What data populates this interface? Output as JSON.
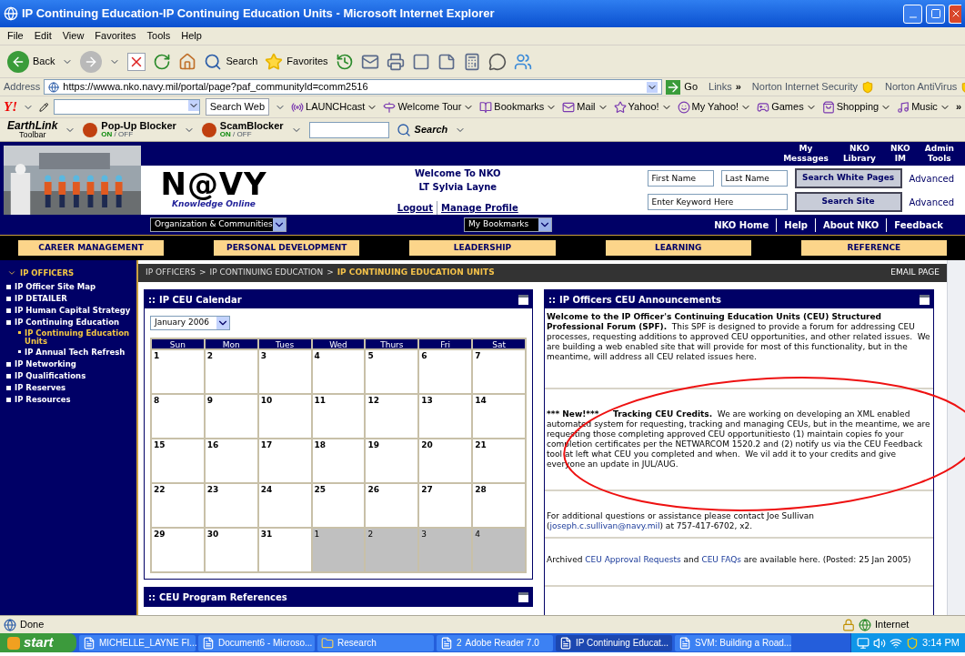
{
  "browser": {
    "title": "IP Continuing Education-IP Continuing Education Units - Microsoft Internet Explorer",
    "menu": [
      "File",
      "Edit",
      "View",
      "Favorites",
      "Tools",
      "Help"
    ],
    "toolbar": {
      "back": "Back",
      "search": "Search",
      "favorites": "Favorites"
    },
    "address": {
      "label": "Address",
      "url": "https://wwwa.nko.navy.mil/portal/page?paf_communityId=comm2516",
      "go": "Go",
      "links": "Links",
      "more": "»",
      "addons": [
        "Norton Internet Security",
        "Norton AntiVirus"
      ]
    },
    "yahoo_bar": {
      "logo": "Y!",
      "search_button": "Search Web",
      "items": [
        "LAUNCHcast",
        "Welcome Tour",
        "Bookmarks",
        "Mail",
        "Yahoo!",
        "My Yahoo!",
        "Games",
        "Shopping",
        "Music"
      ],
      "more": "»"
    },
    "earthlink_bar": {
      "logo": "EarthLink",
      "logo_sub": "Toolbar",
      "blockers": [
        {
          "label": "Pop-Up Blocker",
          "on": "ON",
          "off": "/ OFF"
        },
        {
          "label": "ScamBlocker",
          "on": "ON",
          "off": "/ OFF"
        }
      ],
      "search": "Search"
    }
  },
  "header": {
    "top_links": [
      "My Messages",
      "NKO Library",
      "NKO IM",
      "Admin Tools"
    ],
    "logo": {
      "main": "N@VY",
      "sub": "Knowledge Online"
    },
    "welcome": {
      "line1": "Welcome To NKO",
      "line2": "LT Sylvia Layne",
      "links": [
        "Logout",
        "Manage Profile"
      ]
    },
    "people_search": {
      "fields": [
        {
          "placeholder": "First Name"
        },
        {
          "placeholder": "Last Name"
        }
      ],
      "button": "Search White Pages",
      "advanced": "Advanced"
    },
    "site_search": {
      "placeholder": "Enter Keyword Here",
      "button": "Search Site",
      "advanced": "Advanced"
    },
    "dropdowns": [
      "Organization & Communities",
      "My Bookmarks"
    ],
    "nav_links": [
      "NKO Home",
      "Help",
      "About NKO",
      "Feedback"
    ],
    "tabs": [
      "CAREER MANAGEMENT",
      "PERSONAL DEVELOPMENT",
      "LEADERSHIP",
      "LEARNING",
      "REFERENCE"
    ]
  },
  "sidebar": {
    "title": "IP OFFICERS",
    "items": [
      {
        "label": "IP Officer Site Map",
        "selected": false
      },
      {
        "label": "IP DETAILER",
        "selected": false
      },
      {
        "label": "IP Human Capital Strategy",
        "selected": false
      },
      {
        "label": "IP Continuing Education",
        "selected": false,
        "children": [
          {
            "label": "IP Continuing Education Units",
            "selected": true
          },
          {
            "label": "IP Annual Tech Refresh",
            "selected": false
          }
        ]
      },
      {
        "label": "IP Networking",
        "selected": false
      },
      {
        "label": "IP Qualifications",
        "selected": false
      },
      {
        "label": "IP Reserves",
        "selected": false
      },
      {
        "label": "IP Resources",
        "selected": false
      }
    ]
  },
  "breadcrumb": {
    "items": [
      "IP OFFICERS",
      "IP CONTINUING EDUCATION",
      "IP CONTINUING EDUCATION UNITS"
    ],
    "separator": ">",
    "email": "EMAIL PAGE"
  },
  "calendar": {
    "title": "IP CEU Calendar",
    "handle": "::",
    "month": "January 2006",
    "weekdays": [
      "Sun",
      "Mon",
      "Tues",
      "Wed",
      "Thurs",
      "Fri",
      "Sat"
    ],
    "weeks": [
      [
        {
          "day": "1",
          "outside": false
        },
        {
          "day": "2",
          "outside": false
        },
        {
          "day": "3",
          "outside": false
        },
        {
          "day": "4",
          "outside": false
        },
        {
          "day": "5",
          "outside": false
        },
        {
          "day": "6",
          "outside": false
        },
        {
          "day": "7",
          "outside": false
        }
      ],
      [
        {
          "day": "8",
          "outside": false
        },
        {
          "day": "9",
          "outside": false
        },
        {
          "day": "10",
          "outside": false
        },
        {
          "day": "11",
          "outside": false
        },
        {
          "day": "12",
          "outside": false
        },
        {
          "day": "13",
          "outside": false
        },
        {
          "day": "14",
          "outside": false
        }
      ],
      [
        {
          "day": "15",
          "outside": false
        },
        {
          "day": "16",
          "outside": false
        },
        {
          "day": "17",
          "outside": false
        },
        {
          "day": "18",
          "outside": false
        },
        {
          "day": "19",
          "outside": false
        },
        {
          "day": "20",
          "outside": false
        },
        {
          "day": "21",
          "outside": false
        }
      ],
      [
        {
          "day": "22",
          "outside": false
        },
        {
          "day": "23",
          "outside": false
        },
        {
          "day": "24",
          "outside": false
        },
        {
          "day": "25",
          "outside": false
        },
        {
          "day": "26",
          "outside": false
        },
        {
          "day": "27",
          "outside": false
        },
        {
          "day": "28",
          "outside": false
        }
      ],
      [
        {
          "day": "29",
          "outside": false
        },
        {
          "day": "30",
          "outside": false
        },
        {
          "day": "31",
          "outside": false
        },
        {
          "day": "1",
          "outside": true
        },
        {
          "day": "2",
          "outside": true
        },
        {
          "day": "3",
          "outside": true
        },
        {
          "day": "4",
          "outside": true
        }
      ]
    ]
  },
  "references": {
    "title": "CEU Program References",
    "handle": "::"
  },
  "announcements": {
    "title": "IP Officers CEU Announcements",
    "handle": "::",
    "paragraphs": [
      [
        {
          "kind": "bold",
          "text": "Welcome to the IP Officer's Continuing Education Units (CEU) Structured Professional Forum (SPF)."
        },
        {
          "kind": "plain",
          "text": "  This SPF is designed to provide a forum for addressing CEU processes, requesting additions to approved CEU opportunities, and other related issues.  We are building a web enabled site that will provide for most of this functionality, but in the meantime, will address all CEU related issues here."
        }
      ],
      [
        {
          "kind": "bold",
          "text": "*** New!***     Tracking CEU Credits."
        },
        {
          "kind": "plain",
          "text": "  We are working on developing an XML enabled automated system for requesting, tracking and managing CEUs, but in the meantime, we are requesting those completing approved CEU opportunitiesto (1) maintain copies fo your completion certificates per the NETWARCOM 1520.2 and (2) notify us via the CEU Feedback tool at left what CEU you completed and when.  We vil add it to your credits and give everyone an update in JUL/AUG."
        }
      ],
      [
        {
          "kind": "plain",
          "text": "For additional questions or assistance please contact Joe Sullivan ("
        },
        {
          "kind": "link",
          "text": "joseph.c.sullivan@navy.mil"
        },
        {
          "kind": "plain",
          "text": ") at 757-417-6702, x2."
        }
      ],
      [
        {
          "kind": "plain",
          "text": "Archived "
        },
        {
          "kind": "link",
          "text": "CEU Approval Requests"
        },
        {
          "kind": "plain",
          "text": " and "
        },
        {
          "kind": "link",
          "text": "CEU FAQs"
        },
        {
          "kind": "plain",
          "text": " are available here. (Posted: 25 Jan 2005)"
        }
      ]
    ]
  },
  "annotation": {
    "kind": "ellipse"
  },
  "status_bar": {
    "text": "Done",
    "zone": "Internet"
  },
  "taskbar": {
    "start": "start",
    "tasks": [
      {
        "label": "MICHELLE_LAYNE FI...",
        "selected": false
      },
      {
        "label": "Document6 - Microso...",
        "selected": false
      },
      {
        "label": "Research",
        "selected": false
      },
      {
        "label": "Adobe Reader 7.0",
        "count": "2",
        "selected": false
      },
      {
        "label": "IP Continuing Educat...",
        "selected": true
      },
      {
        "label": "SVM: Building a Road...",
        "selected": false
      }
    ],
    "time": "3:14 PM"
  }
}
